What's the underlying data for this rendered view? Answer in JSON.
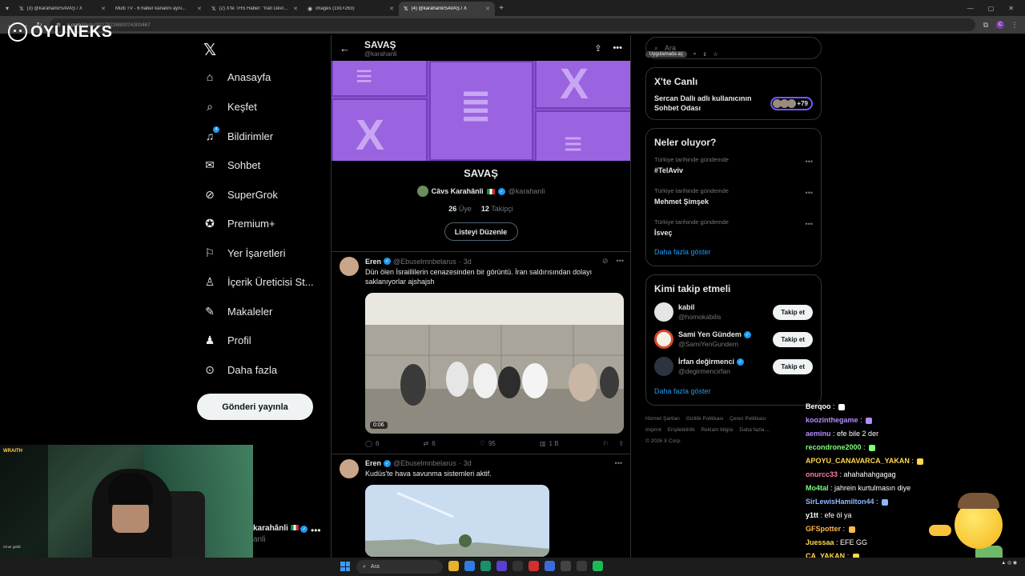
{
  "browser": {
    "tabs": [
      {
        "title": "(3) @karahanli/SAVAŞ / X",
        "active": false
      },
      {
        "title": "Multi TV - 6 haber kanalını aynı...",
        "active": false
      },
      {
        "title": "(2) X'te THS Haber: \"İran Devlet...",
        "active": false
      },
      {
        "title": "images (191×263)",
        "active": false
      },
      {
        "title": "(4) @karahanli/SAVAŞ / X",
        "active": true
      }
    ],
    "new_tab": "+",
    "url_host": "x.com",
    "url_path": "/i/lists/2027822690074300467",
    "app_button": "Uygulamada aç",
    "profile_initial": "C"
  },
  "overlay": {
    "brand": "OYUNEKS"
  },
  "nav": {
    "items": [
      {
        "label": "Anasayfa",
        "icon": "home-icon"
      },
      {
        "label": "Keşfet",
        "icon": "search-icon"
      },
      {
        "label": "Bildirimler",
        "icon": "bell-icon"
      },
      {
        "label": "Sohbet",
        "icon": "mail-icon"
      },
      {
        "label": "SuperGrok",
        "icon": "grok-icon"
      },
      {
        "label": "Premium+",
        "icon": "premium-icon"
      },
      {
        "label": "Yer İşaretleri",
        "icon": "bookmark-icon"
      },
      {
        "label": "İçerik Üreticisi St...",
        "icon": "creator-icon"
      },
      {
        "label": "Makaleler",
        "icon": "article-icon"
      },
      {
        "label": "Profil",
        "icon": "profile-icon"
      },
      {
        "label": "Daha fazla",
        "icon": "more-icon"
      }
    ],
    "notification_count": "4",
    "post_button": "Gönderi yayınla",
    "account_name": "karahânli",
    "account_handle": "anli"
  },
  "list": {
    "title": "SAVAŞ",
    "handle": "@karahanli",
    "owner_name": "Câvs Karahânli",
    "owner_handle": "@karahanli",
    "members_count": "26",
    "members_label": "Üye",
    "followers_count": "12",
    "followers_label": "Takipçi",
    "edit_button": "Listeyi Düzenle"
  },
  "posts": [
    {
      "name": "Eren",
      "handle": "@Ebuselmnbelarus",
      "time": "3d",
      "text": "Dün ölen İsraillilerin cenazesinden bir görüntü. İran saldırısından dolayı saklanıyorlar ajshajsh",
      "video_time": "0:06",
      "replies": "6",
      "reposts": "6",
      "likes": "95",
      "views": "1 B"
    },
    {
      "name": "Eren",
      "handle": "@Ebuselmnbelarus",
      "time": "3d",
      "text": "Kudüs'te hava savunma sistemleri aktif."
    }
  ],
  "sidebar": {
    "search_placeholder": "Ara",
    "live": {
      "title": "X'te Canlı",
      "room": "Sercan Dallı adlı kullanıcının Sohbet Odası",
      "count": "+79"
    },
    "trends": {
      "title": "Neler oluyor?",
      "items": [
        {
          "context": "Türkiye tarihinde gündemde",
          "tag": "#TelAviv"
        },
        {
          "context": "Türkiye tarihinde gündemde",
          "tag": "Mehmet Şimşek"
        },
        {
          "context": "Türkiye tarihinde gündemde",
          "tag": "İsveç"
        }
      ],
      "more": "Daha fazla göster"
    },
    "follow": {
      "title": "Kimi takip etmeli",
      "items": [
        {
          "name": "kabil",
          "handle": "@homokabilis",
          "button": "Takip et",
          "verified": false
        },
        {
          "name": "Sami Yen Gündem",
          "handle": "@SamiYenGundem",
          "button": "Takip et",
          "verified": true
        },
        {
          "name": "İrfan değirmenci",
          "handle": "@degirmencirfan",
          "button": "Takip et",
          "verified": true
        }
      ],
      "more": "Daha fazla göster"
    },
    "footer": [
      "Hizmet Şartları",
      "Gizlilik Politikası",
      "Çerez Politikası",
      "Imprint",
      "Erişilebilirlik",
      "Reklam bilgisi",
      "Daha fazla ...",
      "© 2026 X Corp."
    ]
  },
  "stream_chat": [
    {
      "user": "Berqoo",
      "msg": "",
      "color": "#ffffff"
    },
    {
      "user": "koozinthegame",
      "msg": "",
      "color": "#b58cff"
    },
    {
      "user": "aeminu",
      "msg": "efe bile 2 der",
      "color": "#b58cff"
    },
    {
      "user": "recondrone2000",
      "msg": "",
      "color": "#7dff7d"
    },
    {
      "user": "APOYU_CANAVARCA_YAKAN",
      "msg": "",
      "color": "#ffd84a"
    },
    {
      "user": "onurcc33",
      "msg": "ahahahahgagag",
      "color": "#ff7aa8"
    },
    {
      "user": "Mo4tal",
      "msg": "jahrein kurtulmasın diye",
      "color": "#7dff7d"
    },
    {
      "user": "SirLewisHamilton44",
      "msg": "",
      "color": "#8fb6ff"
    },
    {
      "user": "y1tt",
      "msg": "efe öl ya",
      "color": "#ffffff"
    },
    {
      "user": "GFSpotter",
      "msg": "",
      "color": "#ffb84a"
    },
    {
      "user": "Juessaa",
      "msg": "EFE GG",
      "color": "#ffd84a"
    },
    {
      "user": "CA_YAKAN",
      "msg": "",
      "color": "#ffd84a"
    }
  ],
  "webcam": {
    "label": "WRAITH",
    "last_line": "Ciner geldi"
  },
  "taskbar": {
    "search_placeholder": "Ara"
  }
}
